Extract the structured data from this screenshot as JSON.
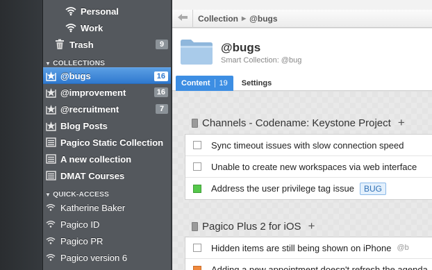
{
  "sidebar": {
    "top_items": [
      {
        "label": "Personal",
        "icon": "wifi-icon"
      },
      {
        "label": "Work",
        "icon": "wifi-icon"
      }
    ],
    "trash": {
      "label": "Trash",
      "count": "9"
    },
    "collections_header": "COLLECTIONS",
    "collections": [
      {
        "label": "@bugs",
        "count": "16",
        "selected": true
      },
      {
        "label": "@improvement",
        "count": "16"
      },
      {
        "label": "@recruitment",
        "count": "7"
      },
      {
        "label": "Blog Posts"
      },
      {
        "label": "Pagico Static Collection"
      },
      {
        "label": "A new collection"
      },
      {
        "label": "DMAT Courses"
      }
    ],
    "quick_access_header": "QUICK-ACCESS",
    "quick_access": [
      {
        "label": "Katherine Baker"
      },
      {
        "label": "Pagico ID"
      },
      {
        "label": "Pagico PR"
      },
      {
        "label": "Pagico version 6"
      }
    ]
  },
  "breadcrumb": {
    "items": [
      "Collection",
      "@bugs"
    ],
    "separator": "▶"
  },
  "header": {
    "title": "@bugs",
    "subtitle": "Smart Collection: @bug",
    "tabs": [
      {
        "label": "Content",
        "count": "19",
        "active": true
      },
      {
        "label": "Settings"
      }
    ]
  },
  "projects": [
    {
      "title": "Channels - Codename: Keystone Project",
      "tasks": [
        {
          "text": "Sync timeout issues with slow connection speed",
          "status": "open"
        },
        {
          "text": "Unable to create new workspaces via web interface",
          "status": "open"
        },
        {
          "text": "Address the user privilege tag issue",
          "status": "done",
          "tag": "BUG"
        }
      ]
    },
    {
      "title": "Pagico Plus 2 for iOS",
      "tasks": [
        {
          "text": "Hidden items are still being shown on iPhone",
          "status": "open",
          "tag_gray": "@b"
        },
        {
          "text": "Adding a new appointment doesn't refresh the agenda",
          "status": "in-progress"
        }
      ]
    }
  ],
  "colors": {
    "selection": "#3d8ee3",
    "sidebar_bg": "#54585d",
    "tag_border": "#8ab8e8",
    "done_green": "#55c84b",
    "progress_orange": "#f0893c"
  }
}
